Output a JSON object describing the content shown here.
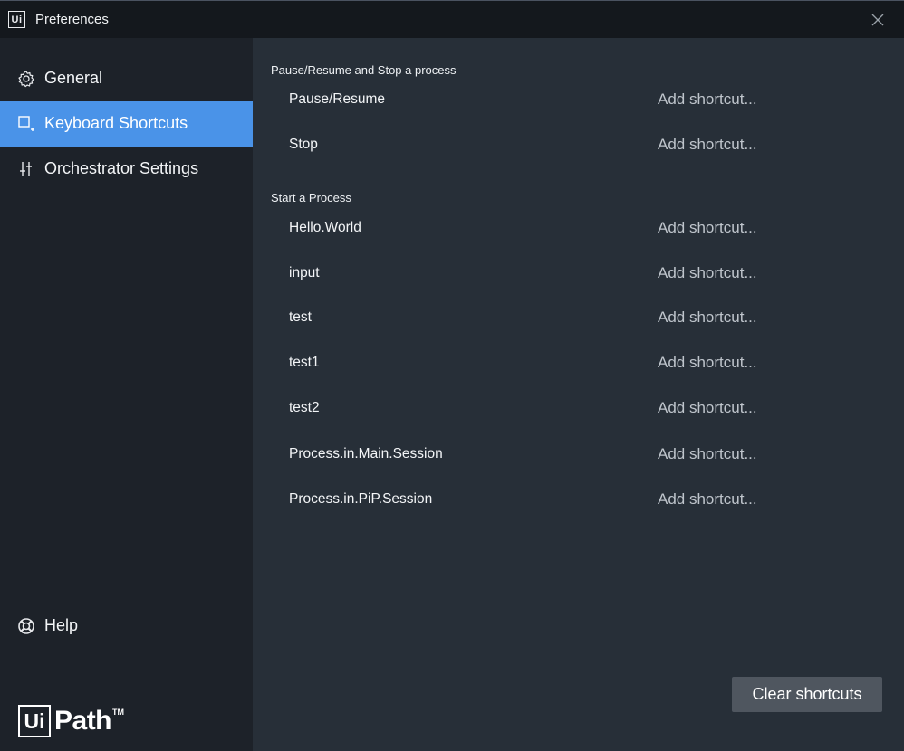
{
  "window": {
    "title": "Preferences",
    "app_icon_text": "Ui"
  },
  "sidebar": {
    "items": [
      {
        "label": "General",
        "icon": "gear-icon",
        "active": false
      },
      {
        "label": "Keyboard Shortcuts",
        "icon": "keyboard-shortcuts-icon",
        "active": true
      },
      {
        "label": "Orchestrator Settings",
        "icon": "sliders-icon",
        "active": false
      }
    ],
    "help_label": "Help",
    "logo": {
      "box": "Ui",
      "word": "Path",
      "tm": "TM"
    }
  },
  "main": {
    "sections": [
      {
        "title": "Pause/Resume and Stop a process",
        "rows": [
          {
            "name": "Pause/Resume",
            "shortcut": "Add shortcut..."
          },
          {
            "name": "Stop",
            "shortcut": "Add shortcut..."
          }
        ]
      },
      {
        "title": "Start a Process",
        "rows": [
          {
            "name": "Hello.World",
            "shortcut": "Add shortcut..."
          },
          {
            "name": "input",
            "shortcut": "Add shortcut..."
          },
          {
            "name": "test",
            "shortcut": "Add shortcut..."
          },
          {
            "name": "test1",
            "shortcut": "Add shortcut..."
          },
          {
            "name": "test2",
            "shortcut": "Add shortcut..."
          },
          {
            "name": "Process.in.Main.Session",
            "shortcut": "Add shortcut..."
          },
          {
            "name": "Process.in.PiP.Session",
            "shortcut": "Add shortcut..."
          }
        ]
      }
    ],
    "clear_button_label": "Clear shortcuts"
  },
  "colors": {
    "accent": "#4a93e8",
    "sidebar_bg": "#1d2229",
    "content_bg": "#272f38",
    "titlebar_bg": "#14181d",
    "button_bg": "#4f565f"
  }
}
